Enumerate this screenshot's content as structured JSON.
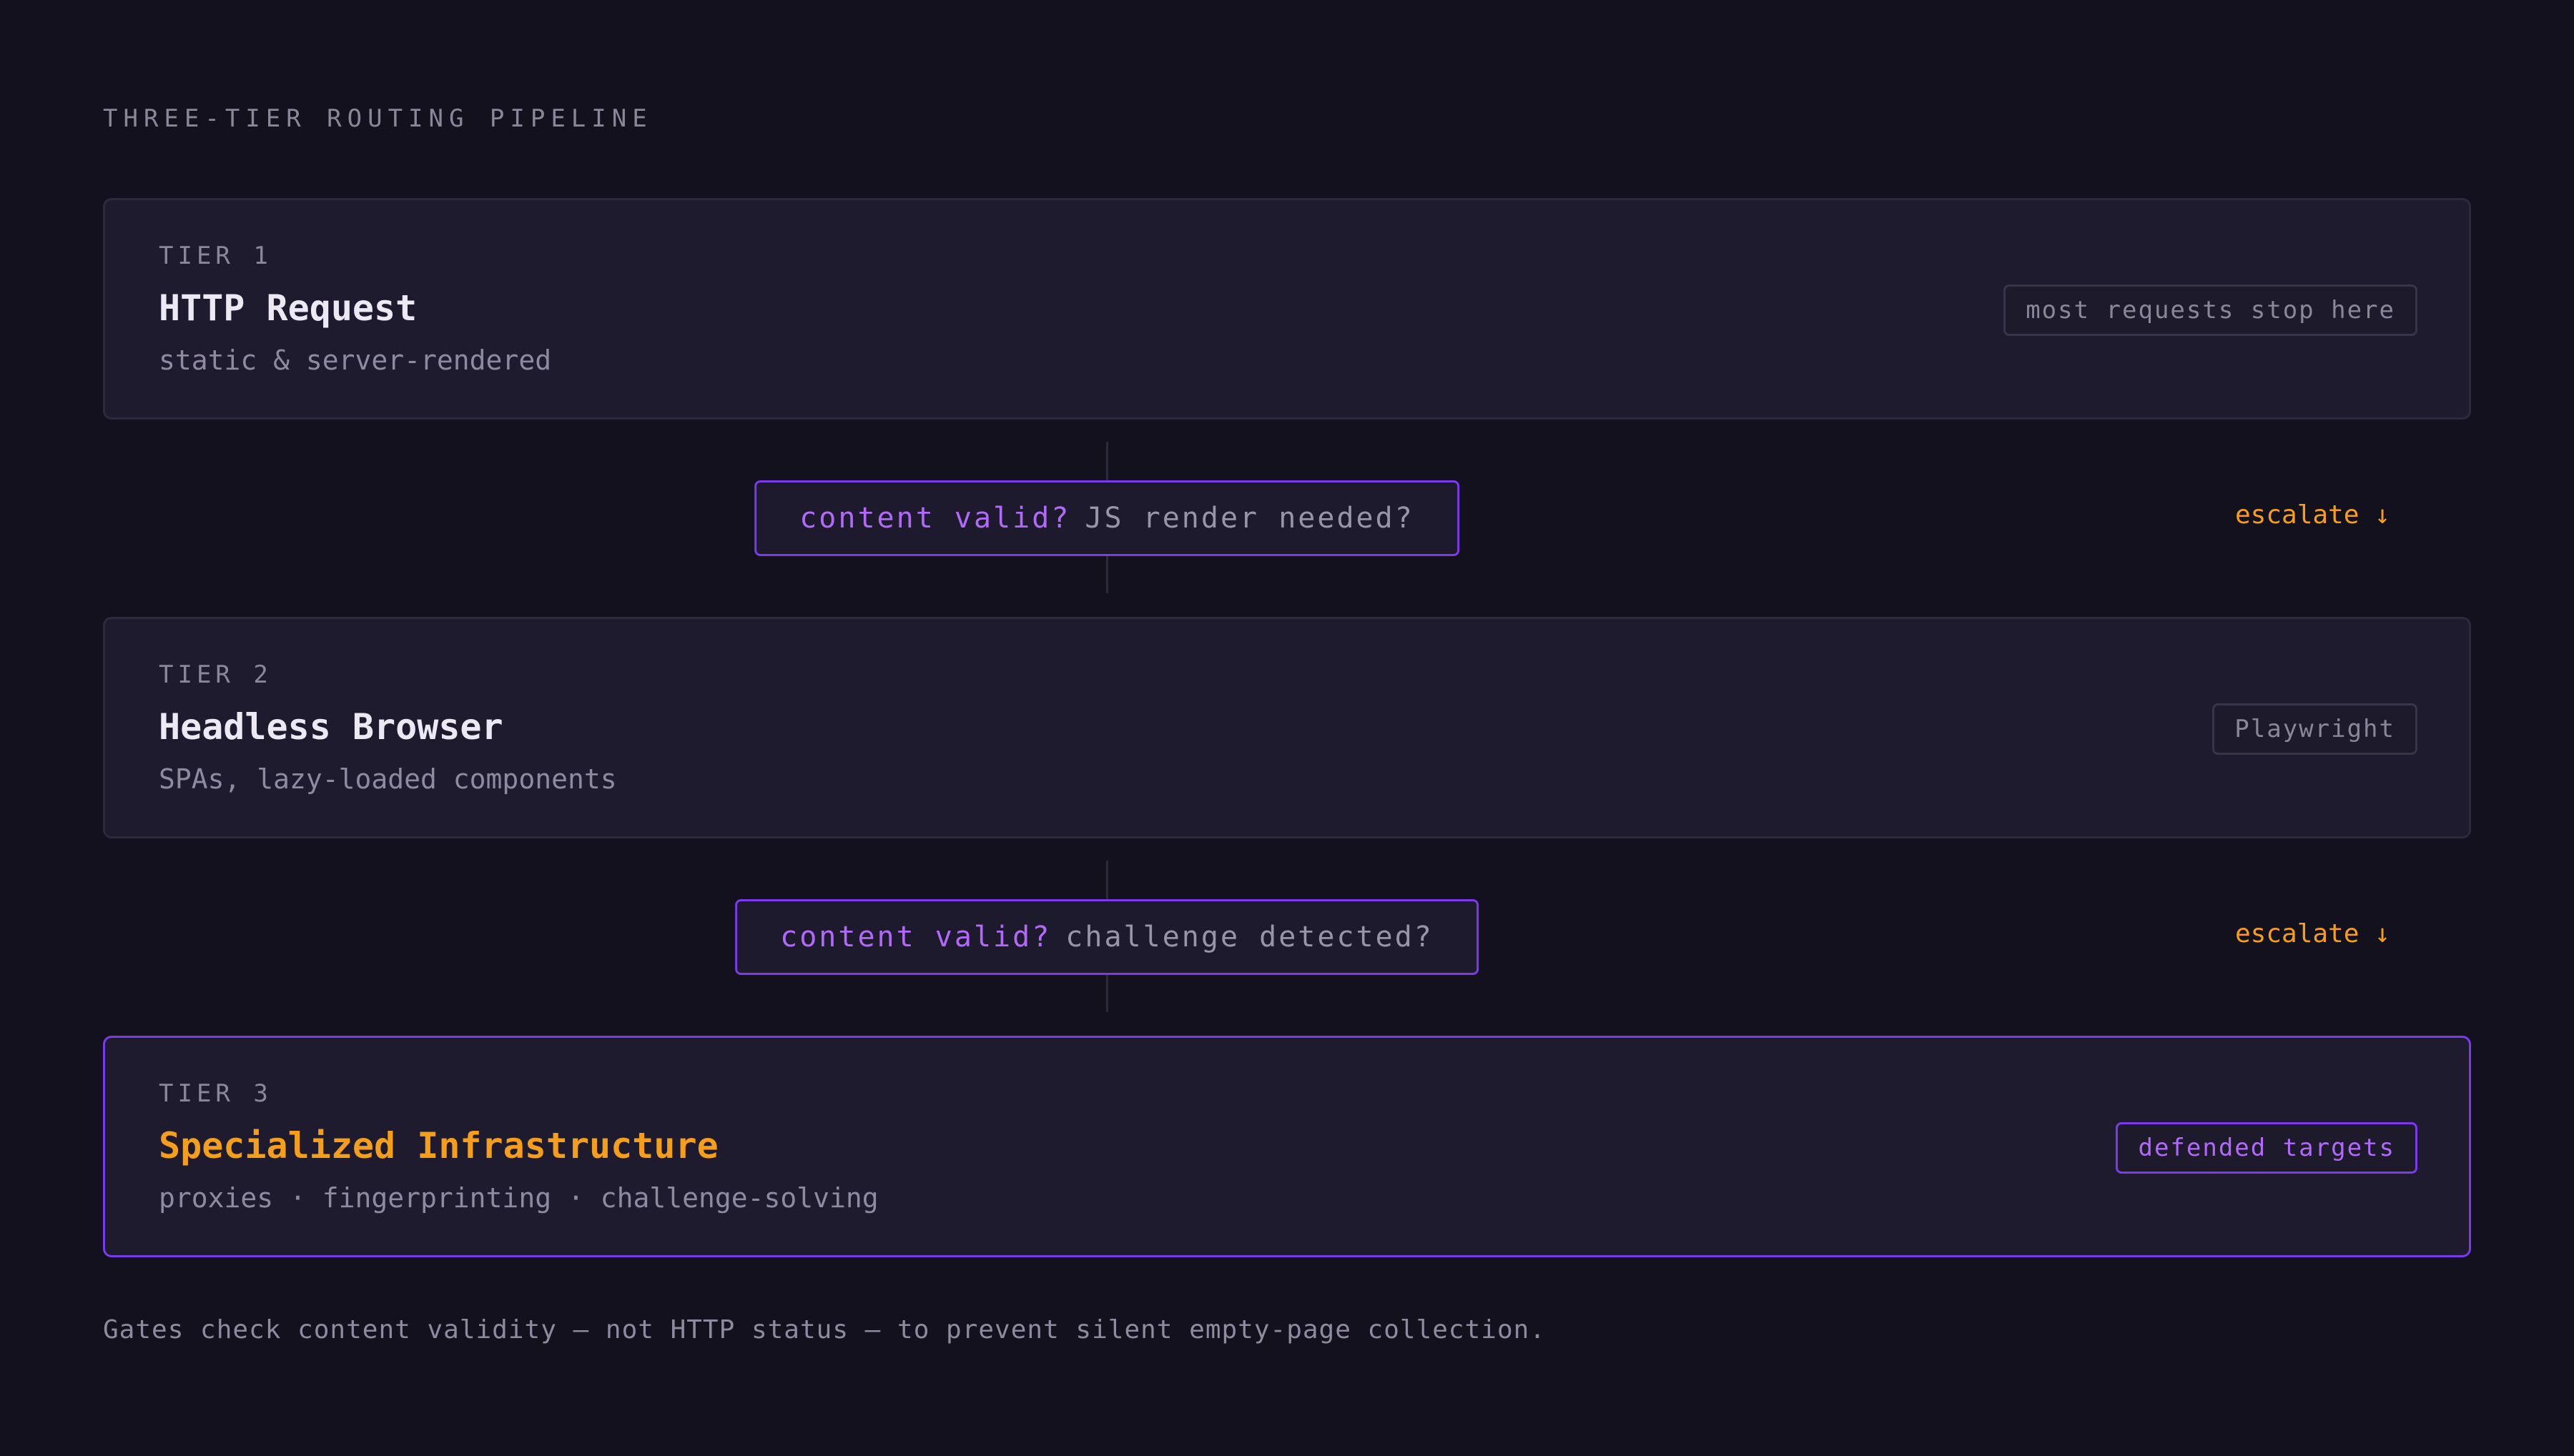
{
  "heading": "THREE-TIER ROUTING PIPELINE",
  "tiers": [
    {
      "label": "TIER 1",
      "title": "HTTP Request",
      "subtitle": "static & server-rendered",
      "badge": "most requests stop here"
    },
    {
      "label": "TIER 2",
      "title": "Headless Browser",
      "subtitle": "SPAs, lazy-loaded components",
      "badge": "Playwright"
    },
    {
      "label": "TIER 3",
      "title": "Specialized Infrastructure",
      "subtitle": "proxies · fingerprinting · challenge-solving",
      "badge": "defended targets"
    }
  ],
  "gates": [
    {
      "check": "content valid?",
      "condition": "JS render needed?",
      "action": "escalate ↓"
    },
    {
      "check": "content valid?",
      "condition": "challenge detected?",
      "action": "escalate ↓"
    }
  ],
  "footnote": "Gates check content validity — not HTTP status — to prevent silent empty-page collection.",
  "colors": {
    "background": "#13111d",
    "card": "#1e1b2e",
    "accent_purple": "#7c3aed",
    "accent_orange": "#f59e1b"
  }
}
